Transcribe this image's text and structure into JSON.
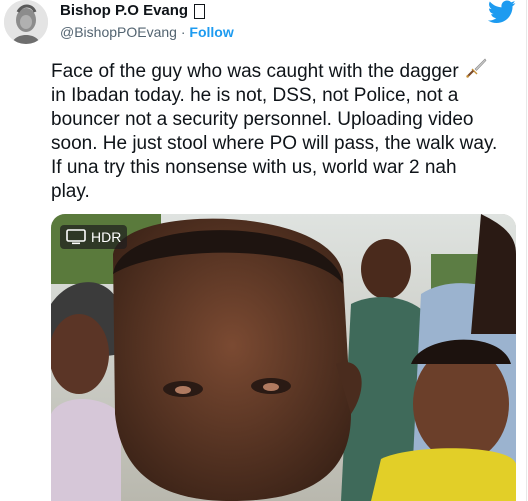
{
  "author": {
    "display_name": "Bishop P.O Evang",
    "handle": "@BishopPOEvang",
    "separator": "·",
    "follow_label": "Follow"
  },
  "icons": {
    "logo": "twitter-bird-icon",
    "emoji": "dagger-icon",
    "hdr": "tv-icon",
    "name_glyph": "missing-glyph-box"
  },
  "tweet": {
    "text": "Face of the guy who was caught with the dagger 🗡\nin Ibadan today. he is not, DSS, not Police, not a\nbouncer not a security personnel. Uploading video\nsoon. He just stool where PO will pass, the walk way.\nIf una try this nonsense with us, world war 2 nah\nplay.",
    "line1": "Face of the guy who was caught with the dagger ",
    "line_rest": "in Ibadan today. he is not, DSS, not Police, not a\nbouncer not a security personnel. Uploading video\nsoon. He just stool where PO will pass, the walk way.\nIf una try this nonsense with us, world war 2 nah\nplay."
  },
  "media": {
    "badge_label": "HDR"
  },
  "colors": {
    "link": "#1d9bf0",
    "secondary_text": "#536471",
    "primary_text": "#0f1419"
  }
}
